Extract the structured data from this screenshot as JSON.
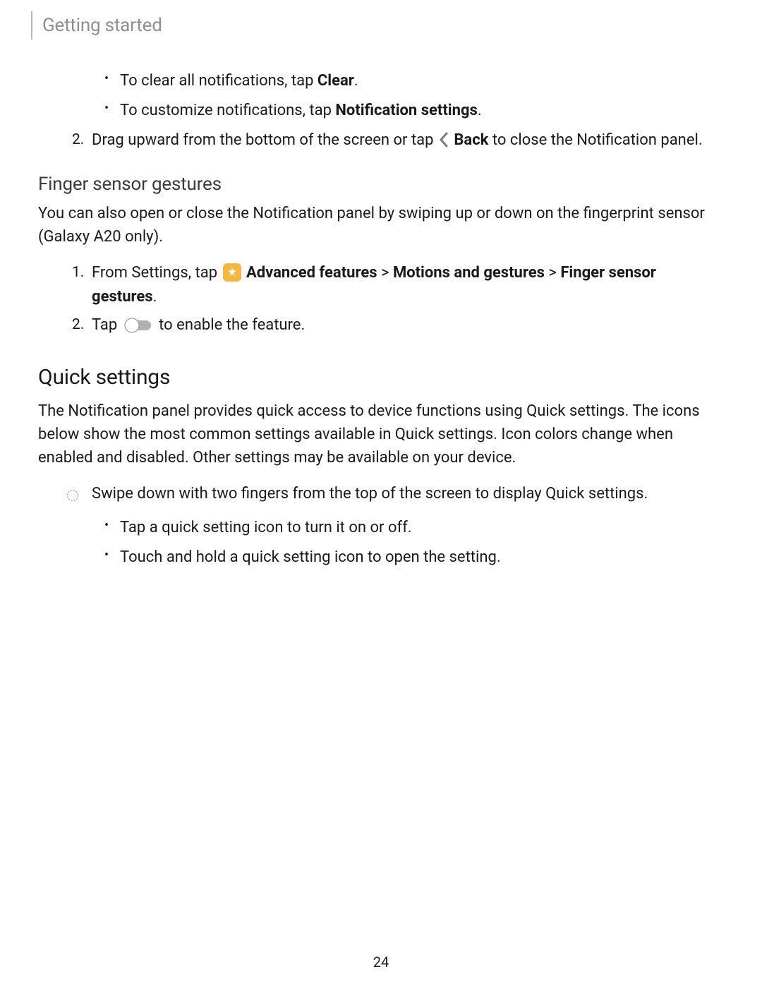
{
  "header": {
    "section_title": "Getting started"
  },
  "page_number": "24",
  "intro_bullets": [
    {
      "prefix": "To clear all notifications, tap ",
      "bold": "Clear",
      "suffix": "."
    },
    {
      "prefix": "To customize notifications, tap ",
      "bold": "Notification settings",
      "suffix": "."
    }
  ],
  "back_step": {
    "num": "2.",
    "prefix": "Drag upward from the bottom of the screen or tap ",
    "bold": "Back",
    "suffix": " to close the Notification panel."
  },
  "finger_sensor": {
    "heading": "Finger sensor gestures",
    "para": "You can also open or close the Notification panel by swiping up or down on the fingerprint sensor (Galaxy A20 only).",
    "step1": {
      "num": "1.",
      "prefix": "From Settings, tap ",
      "path1": "Advanced features",
      "gt1": " > ",
      "path2": "Motions and gestures",
      "gt2": " > ",
      "path3": "Finger sensor gestures",
      "suffix": "."
    },
    "step2": {
      "num": "2.",
      "prefix": "Tap ",
      "suffix": " to enable the feature."
    }
  },
  "quick_settings": {
    "heading": "Quick settings",
    "para": "The Notification panel provides quick access to device functions using Quick settings. The icons below show the most common settings available in Quick settings. Icon colors change when enabled and disabled. Other settings may be available on your device.",
    "swipe": "Swipe down with two fingers from the top of the screen to display Quick settings.",
    "sub_bullets": [
      "Tap a quick setting icon to turn it on or off.",
      "Touch and hold a quick setting icon to open the setting."
    ]
  }
}
